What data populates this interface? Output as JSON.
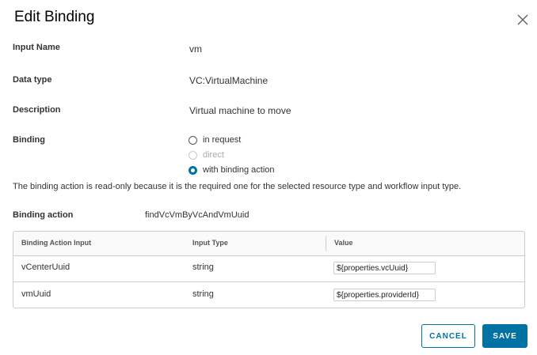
{
  "dialog": {
    "title": "Edit Binding",
    "close_icon": "close-icon"
  },
  "fields": {
    "input_name": {
      "label": "Input Name",
      "value": "vm"
    },
    "data_type": {
      "label": "Data type",
      "value": "VC:VirtualMachine"
    },
    "description": {
      "label": "Description",
      "value": "Virtual machine to move"
    },
    "binding": {
      "label": "Binding",
      "options": [
        {
          "label": "in request",
          "state": "unchecked"
        },
        {
          "label": "direct",
          "state": "disabled"
        },
        {
          "label": "with binding action",
          "state": "checked"
        }
      ]
    }
  },
  "info_text": "The binding action is read-only because it is the required one for the selected resource type and workflow input type.",
  "binding_action": {
    "label": "Binding action",
    "value": "findVcVmByVcAndVmUuid"
  },
  "grid": {
    "columns": [
      "Binding Action Input",
      "Input Type",
      "Value"
    ],
    "rows": [
      {
        "input": "vCenterUuid",
        "type": "string",
        "value": "${properties.vcUuid}"
      },
      {
        "input": "vmUuid",
        "type": "string",
        "value": "${properties.providerId}"
      }
    ]
  },
  "buttons": {
    "cancel": "CANCEL",
    "save": "SAVE"
  },
  "colors": {
    "accent": "#0072a3",
    "border": "#cccccc"
  }
}
